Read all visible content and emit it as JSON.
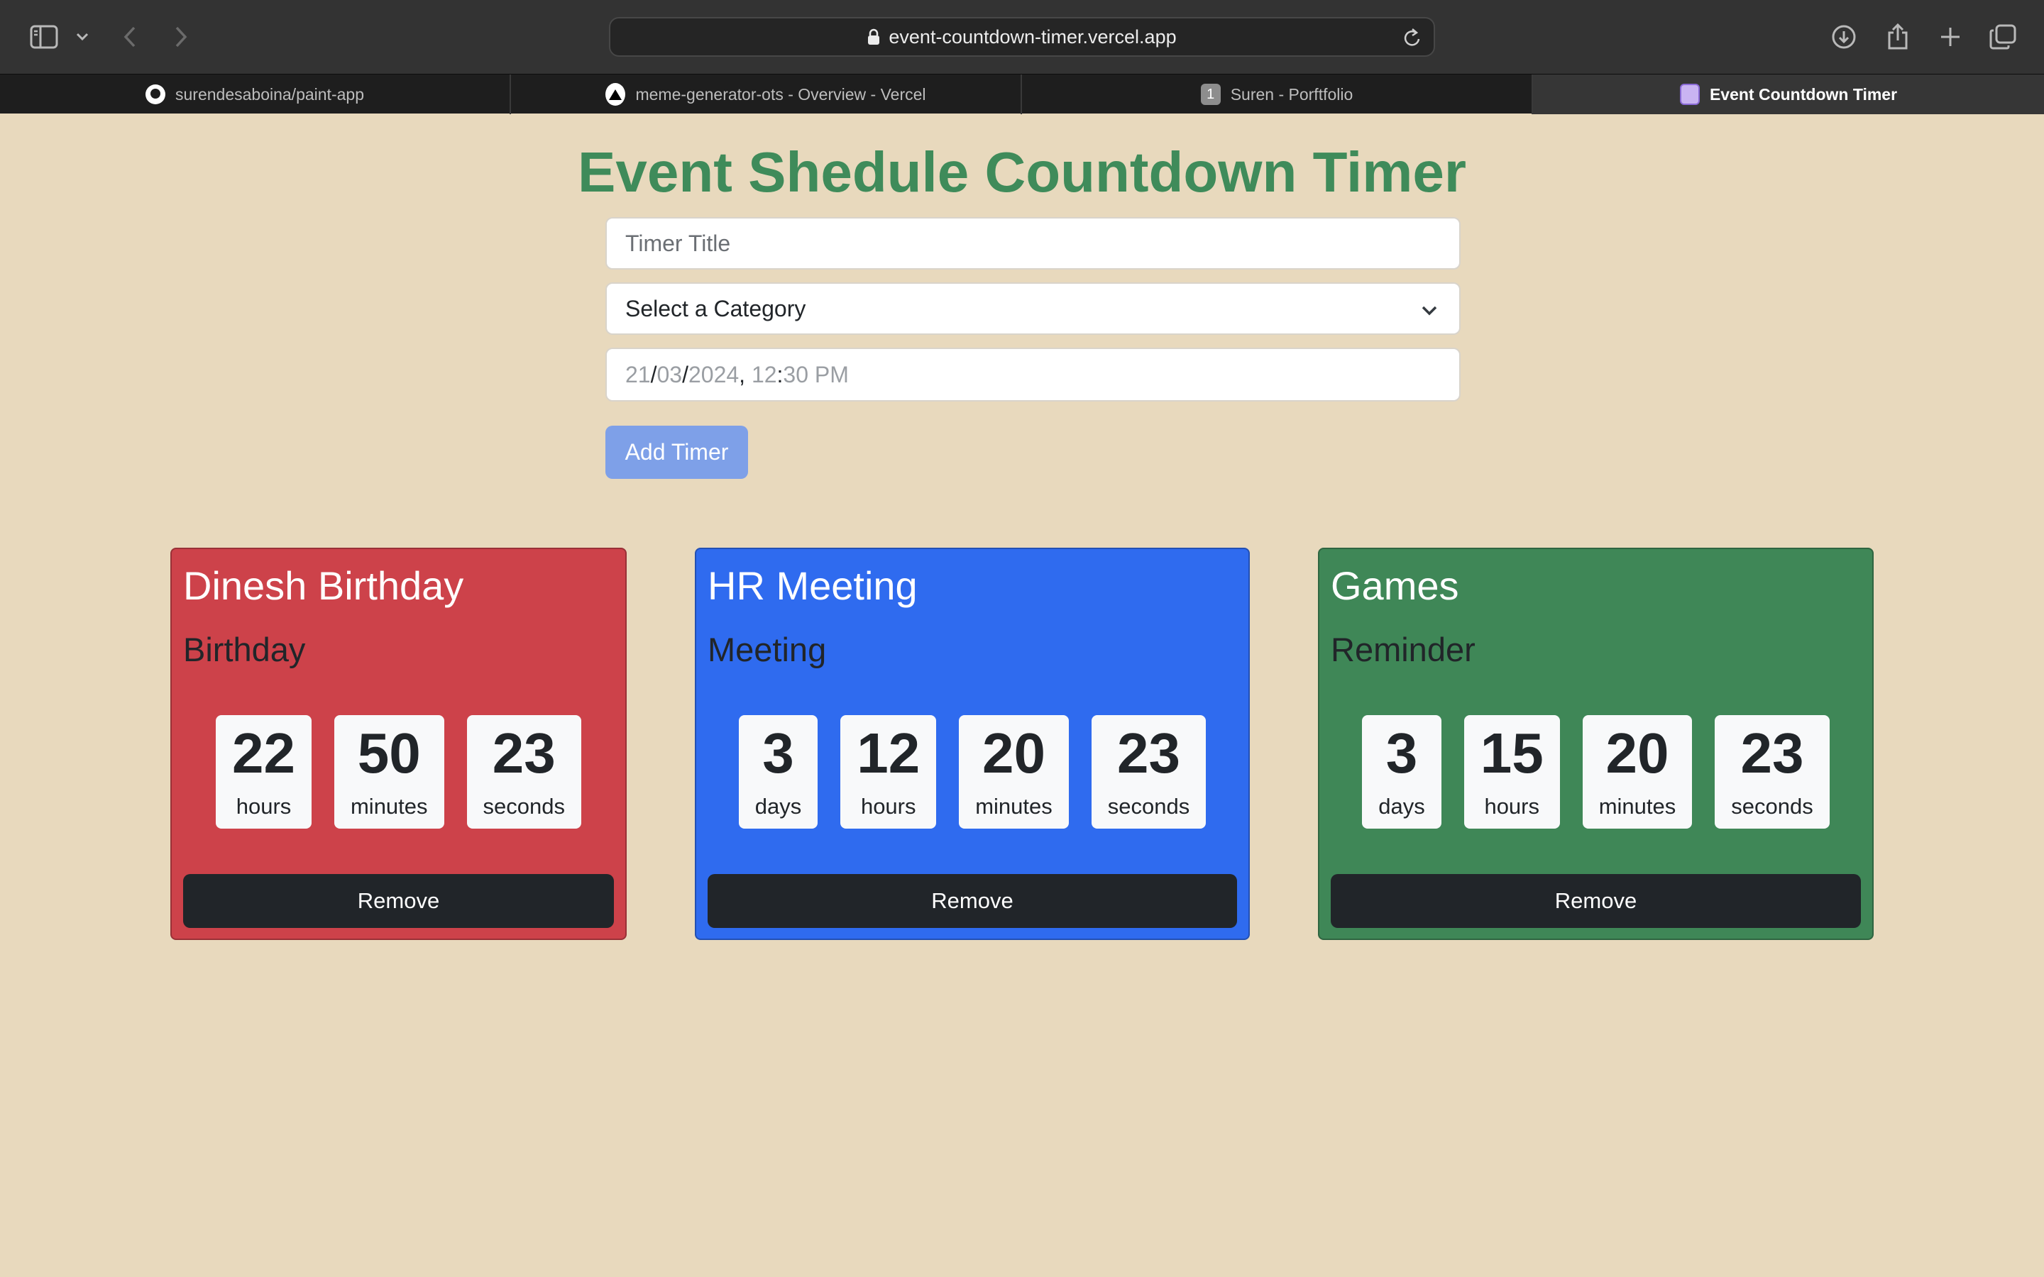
{
  "browser": {
    "url": "event-countdown-timer.vercel.app",
    "tabs": [
      {
        "label": "surendesaboina/paint-app",
        "icon": "github-icon"
      },
      {
        "label": "meme-generator-ots - Overview - Vercel",
        "icon": "vercel-icon"
      },
      {
        "label": "Suren - Porftfolio",
        "icon": "number-1-icon",
        "badge": "1"
      },
      {
        "label": "Event Countdown Timer",
        "icon": "timer-favicon-icon"
      }
    ]
  },
  "page": {
    "title": "Event Shedule Countdown Timer",
    "title_color": "#3f8b5a",
    "background": "#e8d9bd"
  },
  "form": {
    "title_placeholder": "Timer Title",
    "category_selected": "Select a Category",
    "date": {
      "day": "21",
      "month": "03",
      "year": "2024",
      "hour": "12",
      "minute": "30",
      "ampm": "PM"
    },
    "add_button": "Add Timer"
  },
  "timers": [
    {
      "title": "Dinesh Birthday",
      "category": "Birthday",
      "color": "#cd424a",
      "units": [
        {
          "value": "22",
          "label": "hours"
        },
        {
          "value": "50",
          "label": "minutes"
        },
        {
          "value": "23",
          "label": "seconds"
        }
      ],
      "remove_label": "Remove"
    },
    {
      "title": "HR Meeting",
      "category": "Meeting",
      "color": "#2f6bef",
      "units": [
        {
          "value": "3",
          "label": "days"
        },
        {
          "value": "12",
          "label": "hours"
        },
        {
          "value": "20",
          "label": "minutes"
        },
        {
          "value": "23",
          "label": "seconds"
        }
      ],
      "remove_label": "Remove"
    },
    {
      "title": "Games",
      "category": "Reminder",
      "color": "#3f8757",
      "units": [
        {
          "value": "3",
          "label": "days"
        },
        {
          "value": "15",
          "label": "hours"
        },
        {
          "value": "20",
          "label": "minutes"
        },
        {
          "value": "23",
          "label": "seconds"
        }
      ],
      "remove_label": "Remove"
    }
  ]
}
